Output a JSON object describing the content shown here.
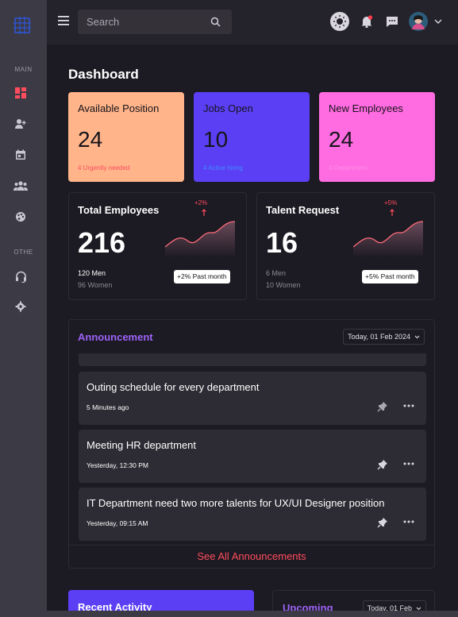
{
  "sidebar": {
    "section_main": "MAIN",
    "section_other": "OTHE",
    "items": [
      {
        "icon": "dashboard-icon"
      },
      {
        "icon": "add-user-icon"
      },
      {
        "icon": "calendar-icon"
      },
      {
        "icon": "team-icon"
      },
      {
        "icon": "palette-icon"
      },
      {
        "icon": "headset-icon"
      },
      {
        "icon": "settings-icon"
      }
    ]
  },
  "topbar": {
    "search_placeholder": "Search"
  },
  "page": {
    "title": "Dashboard"
  },
  "stat_cards": [
    {
      "title": "Available Position",
      "value": "24",
      "subtext": "4 Urgently needed",
      "bg": "#ffb48a",
      "sub_color": "#ff4d5e"
    },
    {
      "title": "Jobs Open",
      "value": "10",
      "subtext": "4 Active hiring",
      "bg": "#5b3ff4",
      "sub_color": "#3f8cff"
    },
    {
      "title": "New Employees",
      "value": "24",
      "subtext": "4 Department",
      "bg": "#ff6be0",
      "sub_color": "#ff8fe9"
    }
  ],
  "total_employees": {
    "title": "Total Employees",
    "value": "216",
    "men": "120 Men",
    "women": "96 Women",
    "change": "+2%",
    "badge": "+2% Past month"
  },
  "talent_request": {
    "title": "Talent Request",
    "value": "16",
    "men": "6 Men",
    "women": "10 Women",
    "change": "+5%",
    "badge": "+5% Past month"
  },
  "announcement": {
    "title": "Announcement",
    "date": "Today, 01 Feb 2024",
    "items": [
      {
        "title": "Outing schedule for every department",
        "time": "5 Minutes ago"
      },
      {
        "title": "Meeting HR department",
        "time": "Yesterday, 12:30 PM"
      },
      {
        "title": "IT Department need two more talents for UX/UI Designer position",
        "time": "Yesterday, 09:15 AM"
      }
    ],
    "see_all": "See All Announcements"
  },
  "recent_activity": {
    "title": "Recent Activity"
  },
  "upcoming": {
    "title": "Upcoming",
    "date": "Today, 01 Feb"
  },
  "colors": {
    "accent_purple": "#9d63f7",
    "accent_red": "#ff4d5e",
    "sidebar_bg": "#3c3a44",
    "main_bg": "#1c1a22"
  }
}
